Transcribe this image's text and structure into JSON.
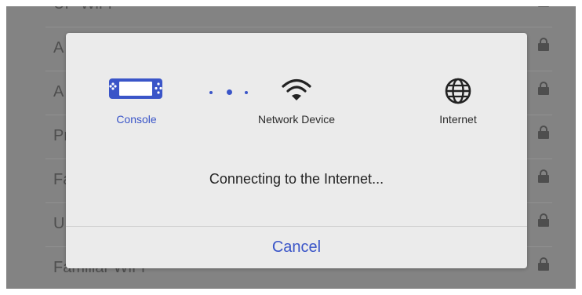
{
  "background_list": [
    {
      "name": "UP-WiFi",
      "locked": true,
      "wifi_icon": "wifi-icon"
    },
    {
      "name": "A",
      "locked": true
    },
    {
      "name": "A",
      "locked": true
    },
    {
      "name": "Pr",
      "locked": true
    },
    {
      "name": "Fa",
      "locked": true
    },
    {
      "name": "U",
      "locked": true
    },
    {
      "name": "Familiar WiFi",
      "locked": true
    }
  ],
  "dialog": {
    "nodes": {
      "console": {
        "label": "Console",
        "icon": "console-icon"
      },
      "network": {
        "label": "Network Device",
        "icon": "wifi-icon"
      },
      "internet": {
        "label": "Internet",
        "icon": "globe-icon"
      }
    },
    "progress_icon": "progress-dots-icon",
    "message": "Connecting to the Internet...",
    "cancel_label": "Cancel"
  },
  "colors": {
    "accent": "#3a55c8",
    "dialog_bg": "#ebebeb",
    "overlay": "#838383"
  }
}
